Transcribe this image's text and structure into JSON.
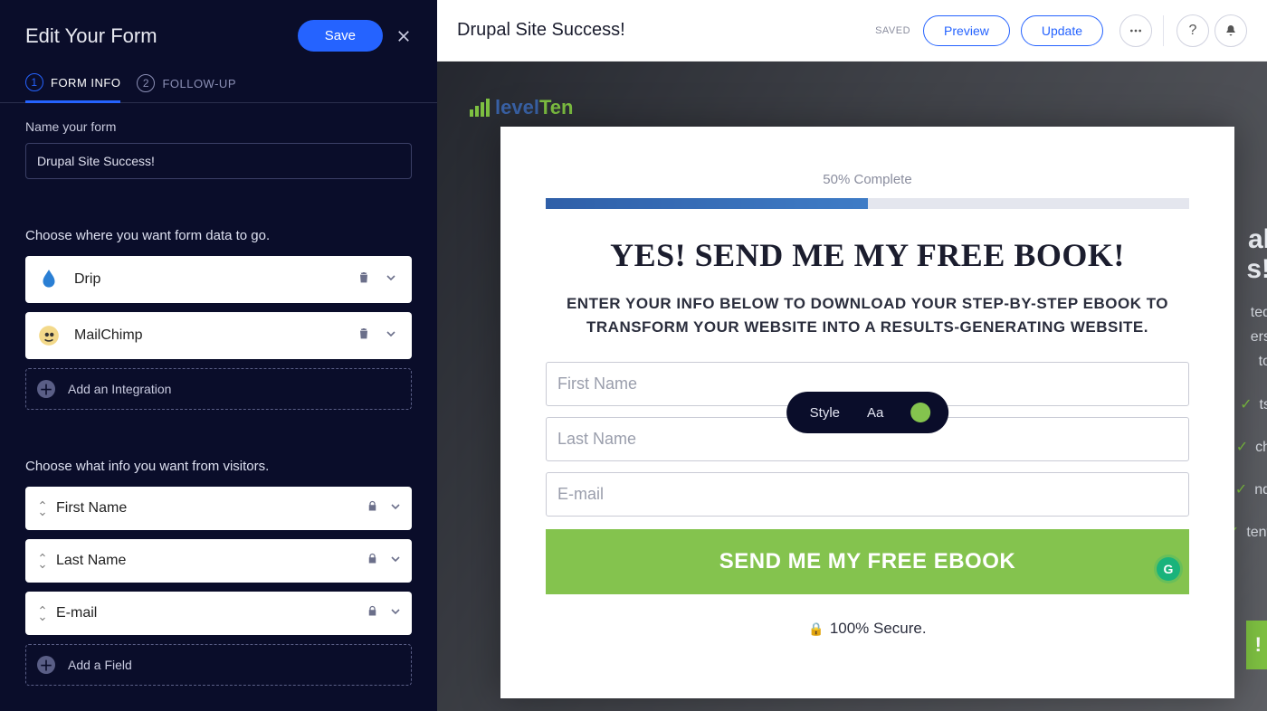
{
  "sidebar": {
    "title": "Edit Your Form",
    "save_label": "Save",
    "tabs": [
      {
        "num": "1",
        "label": "FORM INFO"
      },
      {
        "num": "2",
        "label": "FOLLOW-UP"
      }
    ],
    "name_label": "Name your form",
    "form_name_value": "Drupal Site Success!",
    "dest_label": "Choose where you want form data to go.",
    "integrations": [
      {
        "name": "Drip"
      },
      {
        "name": "MailChimp"
      }
    ],
    "add_integration": "Add an Integration",
    "fields_label": "Choose what info you want from visitors.",
    "fields": [
      {
        "name": "First Name"
      },
      {
        "name": "Last Name"
      },
      {
        "name": "E-mail"
      }
    ],
    "add_field": "Add a Field"
  },
  "topbar": {
    "title": "Drupal Site Success!",
    "saved": "SAVED",
    "preview": "Preview",
    "update": "Update",
    "help": "?"
  },
  "preview": {
    "logo_a": "level",
    "logo_b": "Ten",
    "progress_text": "50% Complete",
    "progress_pct": 50,
    "headline": "YES! SEND ME MY FREE BOOK!",
    "subhead": "ENTER YOUR INFO BELOW TO DOWNLOAD YOUR STEP-BY-STEP EBOOK TO TRANSFORM YOUR WEBSITE INTO A RESULTS-GENERATING WEBSITE.",
    "ph_first": "First Name",
    "ph_last": "Last Name",
    "ph_email": "E-mail",
    "cta": "SEND ME MY FREE EBOOK",
    "secure": "100% Secure.",
    "pill_style": "Style",
    "pill_aa": "Aa",
    "bg_big1": "al",
    "bg_big2": "s!",
    "bg_t1": "ted",
    "bg_t2": "ers",
    "bg_t3": "to",
    "bg_li1": "ts",
    "bg_li2": "ch",
    "bg_li3": "nd",
    "bg_li4": "tent",
    "bg_cta": "!"
  }
}
